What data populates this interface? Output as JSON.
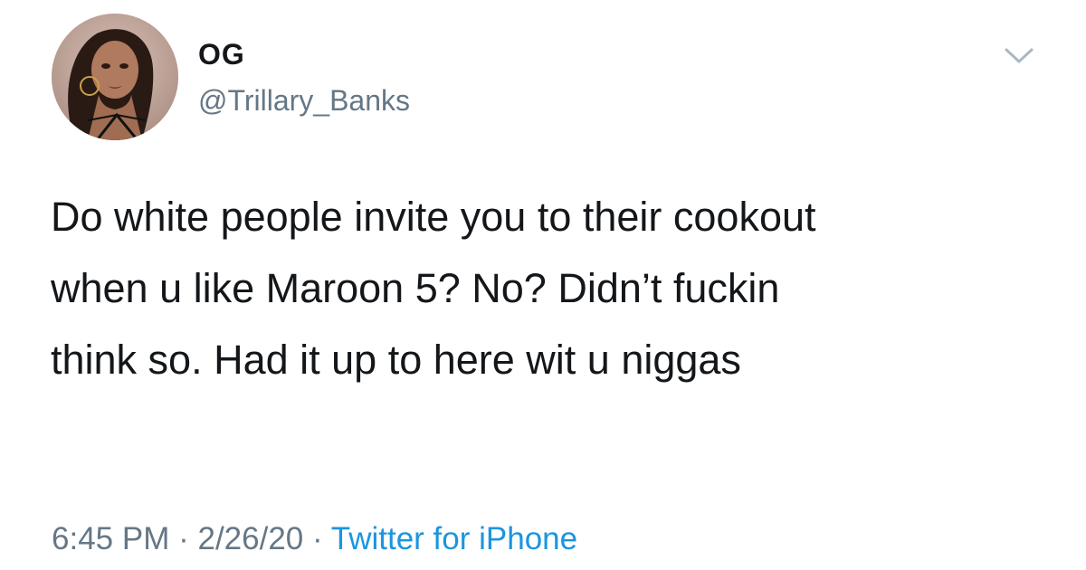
{
  "author": {
    "display_name": "OG",
    "handle": "@Trillary_Banks",
    "avatar_icon": "profile-photo"
  },
  "menu": {
    "icon": "chevron-down-icon"
  },
  "tweet": {
    "line1": "Do white people invite you to their cookout",
    "line2": "when u like Maroon 5? No? Didn’t fuckin",
    "line3": "think so. Had it up to here wit u niggas"
  },
  "meta": {
    "time": "6:45 PM",
    "separator": "·",
    "date": "2/26/20",
    "source": "Twitter for iPhone"
  },
  "colors": {
    "text": "#14171a",
    "secondary": "#657786",
    "link": "#1b95e0",
    "chevron": "#aab8c2"
  }
}
